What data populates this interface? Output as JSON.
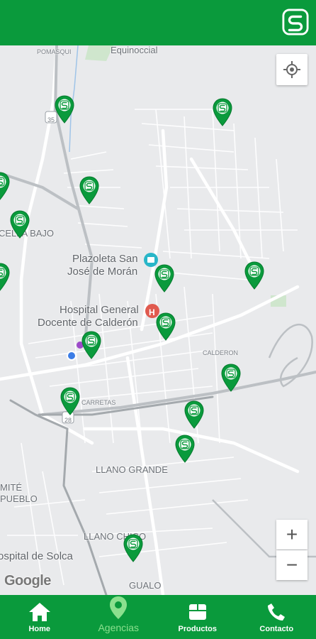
{
  "app": {
    "brand_color": "#0a9a3c",
    "logo_icon": "s-logo-icon"
  },
  "map": {
    "places": {
      "equinoccial": "Equinoccial",
      "pomasqui": "POMASQUI",
      "plazoleta_1": "Plazoleta San",
      "plazoleta_2": "José de Morán",
      "hospital_1": "Hospital General",
      "hospital_2": "Docente de Calderón",
      "calderon": "CALDERON",
      "carretas": "CARRETAS",
      "llano_grande": "LLANO GRANDE",
      "llano_chico": "LLANO CHICO",
      "gualo": "GUALO",
      "cella_bajo": "CELLA BAJO",
      "mite": "MITÉ",
      "pueblo": "PUEBLO",
      "solca": "ospital de Solca",
      "route_28": "28",
      "route_35": "35"
    },
    "attribution": "Google",
    "zoom_in": "+",
    "zoom_out": "−"
  },
  "nav": {
    "items": [
      {
        "label": "Home",
        "icon": "home-icon"
      },
      {
        "label": "Agencias",
        "icon": "map-pin-icon",
        "active": true
      },
      {
        "label": "Productos",
        "icon": "box-icon"
      },
      {
        "label": "Contacto",
        "icon": "phone-icon"
      }
    ]
  }
}
